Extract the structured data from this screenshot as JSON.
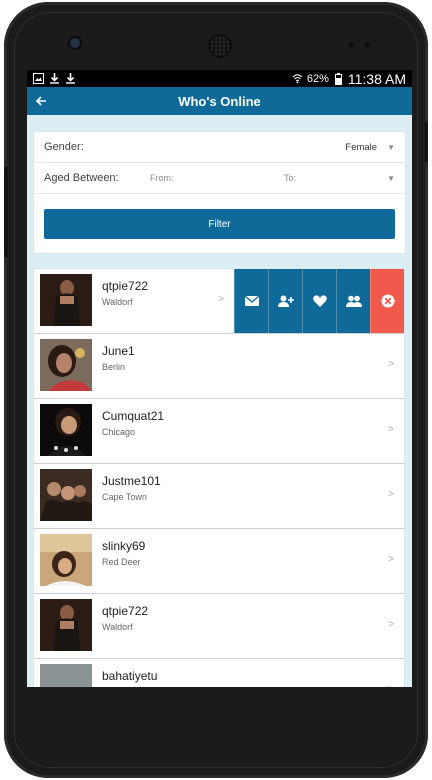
{
  "status": {
    "battery": "62%",
    "time": "11:38 AM"
  },
  "header": {
    "title": "Who's Online"
  },
  "filter": {
    "gender_label": "Gender:",
    "gender_value": "Female",
    "aged_label": "Aged Between:",
    "from_placeholder": "From:",
    "to_placeholder": "To:",
    "button": "Filter"
  },
  "users": [
    {
      "name": "qtpie722",
      "location": "Waldorf"
    },
    {
      "name": "June1",
      "location": "Berlin"
    },
    {
      "name": "Cumquat21",
      "location": "Chicago"
    },
    {
      "name": "Justme101",
      "location": "Cape Town"
    },
    {
      "name": "slinky69",
      "location": "Red Deer"
    },
    {
      "name": "qtpie722",
      "location": "Waldorf"
    },
    {
      "name": "bahatiyetu",
      "location": ""
    }
  ],
  "row_actions": [
    "mail-icon",
    "add-friend-icon",
    "heart-icon",
    "friends-icon",
    "close-icon"
  ],
  "colors": {
    "primary": "#0f6a9a",
    "danger": "#ef5a4c",
    "background": "#dbeef3"
  }
}
